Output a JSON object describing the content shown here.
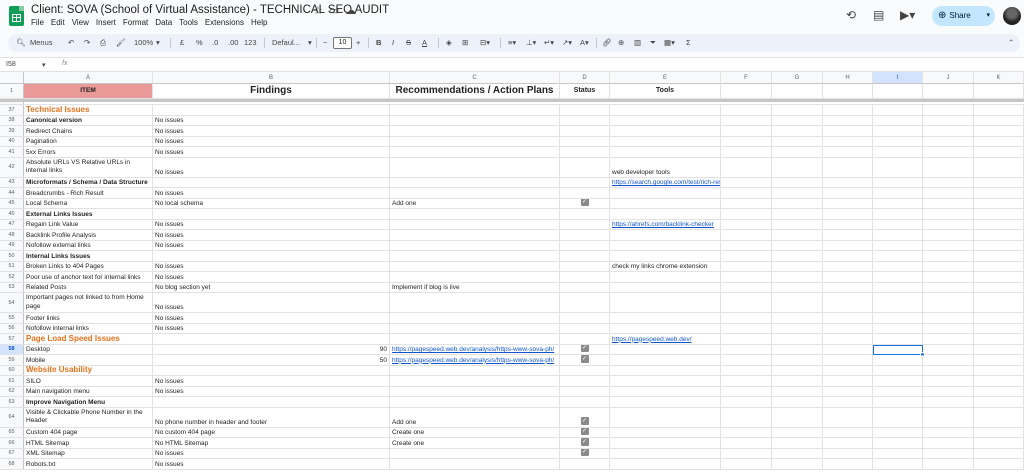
{
  "app": {
    "doc_title": "Client: SOVA (School of Virtual Assistance) - TECHNICAL SEO AUDIT",
    "menu": [
      "File",
      "Edit",
      "View",
      "Insert",
      "Format",
      "Data",
      "Tools",
      "Extensions",
      "Help"
    ],
    "share_label": "Share",
    "accent": "#c2e7ff",
    "icons": [
      "history-icon",
      "comment-icon",
      "video-meet-icon",
      "globe-icon"
    ]
  },
  "toolbar": {
    "search_label": "Menus",
    "zoom": "100%",
    "currency": "£",
    "percent": "%",
    "dec_decrease": ".0",
    "dec_increase": ".00",
    "number_format": "123",
    "font": "Defaul...",
    "font_size": "10"
  },
  "formula_bar": {
    "name_box": "I58",
    "fx": "fx",
    "content": ""
  },
  "columns": [
    "A",
    "B",
    "C",
    "D",
    "E",
    "F",
    "G",
    "H",
    "I",
    "J",
    "K"
  ],
  "selected_column": "I",
  "header_row": {
    "num": "1",
    "a": "ITEM",
    "b": "Findings",
    "c": "Recommendations / Action Plans",
    "d": "Status",
    "e": "Tools"
  },
  "rows": [
    {
      "num": "37",
      "a": "Technical Issues",
      "style": "section"
    },
    {
      "num": "38",
      "a": "Canonical version",
      "style": "sub",
      "b": "No issues"
    },
    {
      "num": "39",
      "a": "Redirect Chains",
      "b": "No issues"
    },
    {
      "num": "40",
      "a": "Pagination",
      "b": "No issues"
    },
    {
      "num": "41",
      "a": "5xx Errors",
      "b": "No issues"
    },
    {
      "num": "42",
      "a": "Absolute URLs VS Relative URLs in internal links",
      "b": "No issues",
      "e": "web developer tools",
      "tall": true
    },
    {
      "num": "43",
      "a": "Microformats / Schema / Data Structure",
      "style": "sub",
      "e": "https://search.google.com/test/rich-results",
      "e_link": true
    },
    {
      "num": "44",
      "a": "Breadcrumbs - Rich Result",
      "b": "No issues"
    },
    {
      "num": "45",
      "a": "Local Schema",
      "b": "No local schema",
      "c": "Add one",
      "d_check": true
    },
    {
      "num": "46",
      "a": "External Links Issues",
      "style": "sub"
    },
    {
      "num": "47",
      "a": "Regain Link Value",
      "b": "No issues",
      "e": "https://ahrefs.com/backlink-checker",
      "e_link": true
    },
    {
      "num": "48",
      "a": "Backlink Profile Analysis",
      "b": "No issues"
    },
    {
      "num": "49",
      "a": "Nofollow external links",
      "b": "No issues"
    },
    {
      "num": "50",
      "a": "Internal Links Issues",
      "style": "sub"
    },
    {
      "num": "51",
      "a": "Broken Links to 404 Pages",
      "b": "No issues",
      "e": "check my links chrome extension"
    },
    {
      "num": "52",
      "a": "Poor use of anchor text for internal links",
      "b": "No issues"
    },
    {
      "num": "53",
      "a": "Related Posts",
      "b": "No blog section yet",
      "c": "Implement if blog is live"
    },
    {
      "num": "54",
      "a": "Important pages not linked to from Home page",
      "b": "No issues",
      "tall": true
    },
    {
      "num": "55",
      "a": "Footer links",
      "b": "No issues"
    },
    {
      "num": "56",
      "a": "Nofollow internal links",
      "b": "No issues"
    },
    {
      "num": "57",
      "a": "Page Load Speed Issues",
      "style": "section",
      "e": "https://pagespeed.web.dev/",
      "e_link": true
    },
    {
      "num": "58",
      "a": "Desktop",
      "b_num": "90",
      "c": "https://pagespeed.web.dev/analysis/https-www-sova-ph/",
      "c_link": true,
      "d_check": true,
      "selected": true
    },
    {
      "num": "59",
      "a": "Mobile",
      "b_num": "50",
      "c": "https://pagespeed.web.dev/analysis/https-www-sova-ph/",
      "c_link": true,
      "d_check": true
    },
    {
      "num": "60",
      "a": "Website Usability",
      "style": "section"
    },
    {
      "num": "61",
      "a": "SILO",
      "b": "No issues"
    },
    {
      "num": "62",
      "a": "Main navigation menu",
      "b": "No issues"
    },
    {
      "num": "63",
      "a": "Improve Navigation Menu",
      "style": "sub"
    },
    {
      "num": "64",
      "a": "Visible & Clickable Phone Number in the Header",
      "b": "No phone number in header and footer",
      "c": "Add one",
      "d_check": true,
      "tall": true
    },
    {
      "num": "65",
      "a": "Custom 404 page",
      "b": "No custom 404 page",
      "c": "Create one",
      "d_check": true
    },
    {
      "num": "66",
      "a": "HTML Sitemap",
      "b": "No HTML Sitemap",
      "c": "Create one",
      "d_check": true
    },
    {
      "num": "67",
      "a": "XML Sitemap",
      "b": "No issues",
      "d_check": true
    },
    {
      "num": "68",
      "a": "Robots.txt",
      "b": "No issues"
    }
  ]
}
